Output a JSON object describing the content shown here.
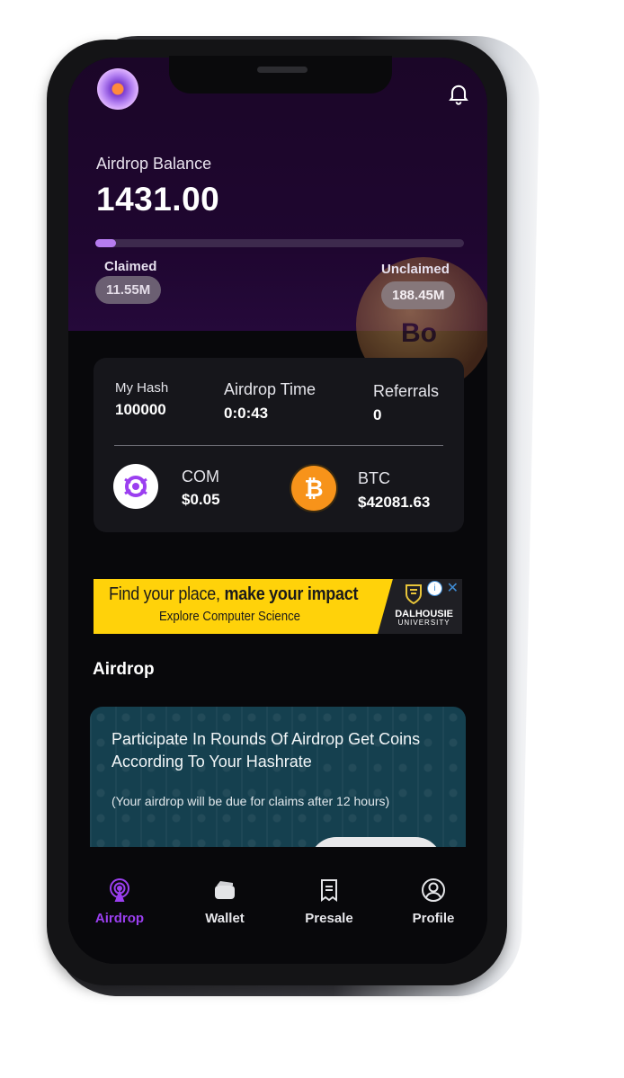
{
  "header": {
    "balance_label": "Airdrop Balance",
    "balance_value": "1431.00",
    "progress_fraction": 0.055,
    "claimed_label": "Claimed",
    "claimed_value": "11.55M",
    "unclaimed_label": "Unclaimed",
    "unclaimed_value": "188.45M",
    "coin_letters": "Bo"
  },
  "stats": {
    "hash_label": "My Hash",
    "hash_value": "100000",
    "time_label": "Airdrop Time",
    "time_value": "0:0:43",
    "referrals_label": "Referrals",
    "referrals_value": "0",
    "com_label": "COM",
    "com_price": "$0.05",
    "btc_label": "BTC",
    "btc_symbol": "₿",
    "btc_price": "$42081.63"
  },
  "ad": {
    "headline_regular": "Find your place, ",
    "headline_bold": "make your impact",
    "subline": "Explore Computer Science",
    "brand": "DALHOUSIE",
    "brand_sub": "UNIVERSITY",
    "info_glyph": "i",
    "close_glyph": "✕"
  },
  "section": {
    "title": "Airdrop"
  },
  "airdrop_card": {
    "text": "Participate In Rounds Of Airdrop Get Coins According To Your Hashrate",
    "note": "(Your airdrop will be due for claims after 12 hours)"
  },
  "nav": {
    "airdrop": "Airdrop",
    "wallet": "Wallet",
    "presale": "Presale",
    "profile": "Profile"
  },
  "colors": {
    "accent": "#b67cf0",
    "nav_active": "#9b3ff0",
    "btc": "#f7931a"
  }
}
